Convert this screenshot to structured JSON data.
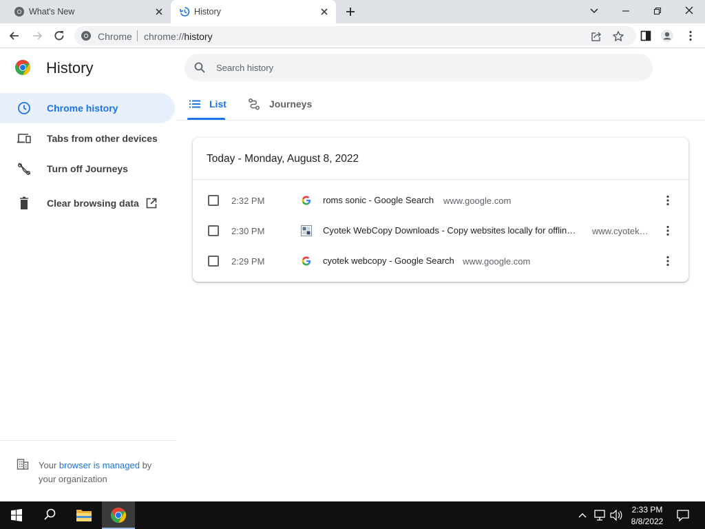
{
  "browser": {
    "tabs": [
      {
        "title": "What's New",
        "active": false
      },
      {
        "title": "History",
        "active": true
      }
    ],
    "omnibox": {
      "site_label": "Chrome",
      "url_host": "chrome://",
      "url_path": "history"
    }
  },
  "sidebar": {
    "title": "History",
    "items": [
      {
        "label": "Chrome history",
        "icon": "clock-icon",
        "active": true
      },
      {
        "label": "Tabs from other devices",
        "icon": "devices-icon",
        "active": false
      },
      {
        "label": "Turn off Journeys",
        "icon": "journeys-off-icon",
        "active": false
      },
      {
        "label": "Clear browsing data",
        "icon": "trash-icon",
        "active": false
      }
    ],
    "managed": {
      "prefix": "Your ",
      "link": "browser is managed",
      "suffix": " by your organization"
    }
  },
  "search": {
    "placeholder": "Search history",
    "value": ""
  },
  "tabs": [
    {
      "label": "List",
      "active": true
    },
    {
      "label": "Journeys",
      "active": false
    }
  ],
  "history": {
    "date_heading": "Today - Monday, August 8, 2022",
    "entries": [
      {
        "time": "2:32 PM",
        "title": "roms sonic - Google Search",
        "domain": "www.google.com",
        "favicon": "google-icon"
      },
      {
        "time": "2:30 PM",
        "title": "Cyotek WebCopy Downloads - Copy websites locally for offline browsing",
        "domain": "www.cyotek.com",
        "favicon": "cyotek-icon"
      },
      {
        "time": "2:29 PM",
        "title": "cyotek webcopy - Google Search",
        "domain": "www.google.com",
        "favicon": "google-icon"
      }
    ]
  },
  "taskbar": {
    "time": "2:33 PM",
    "date": "8/8/2022"
  },
  "colors": {
    "accent": "#1a73e8",
    "active_nav_bg": "#e8f0fe",
    "tabstrip_bg": "#dee1e6"
  }
}
